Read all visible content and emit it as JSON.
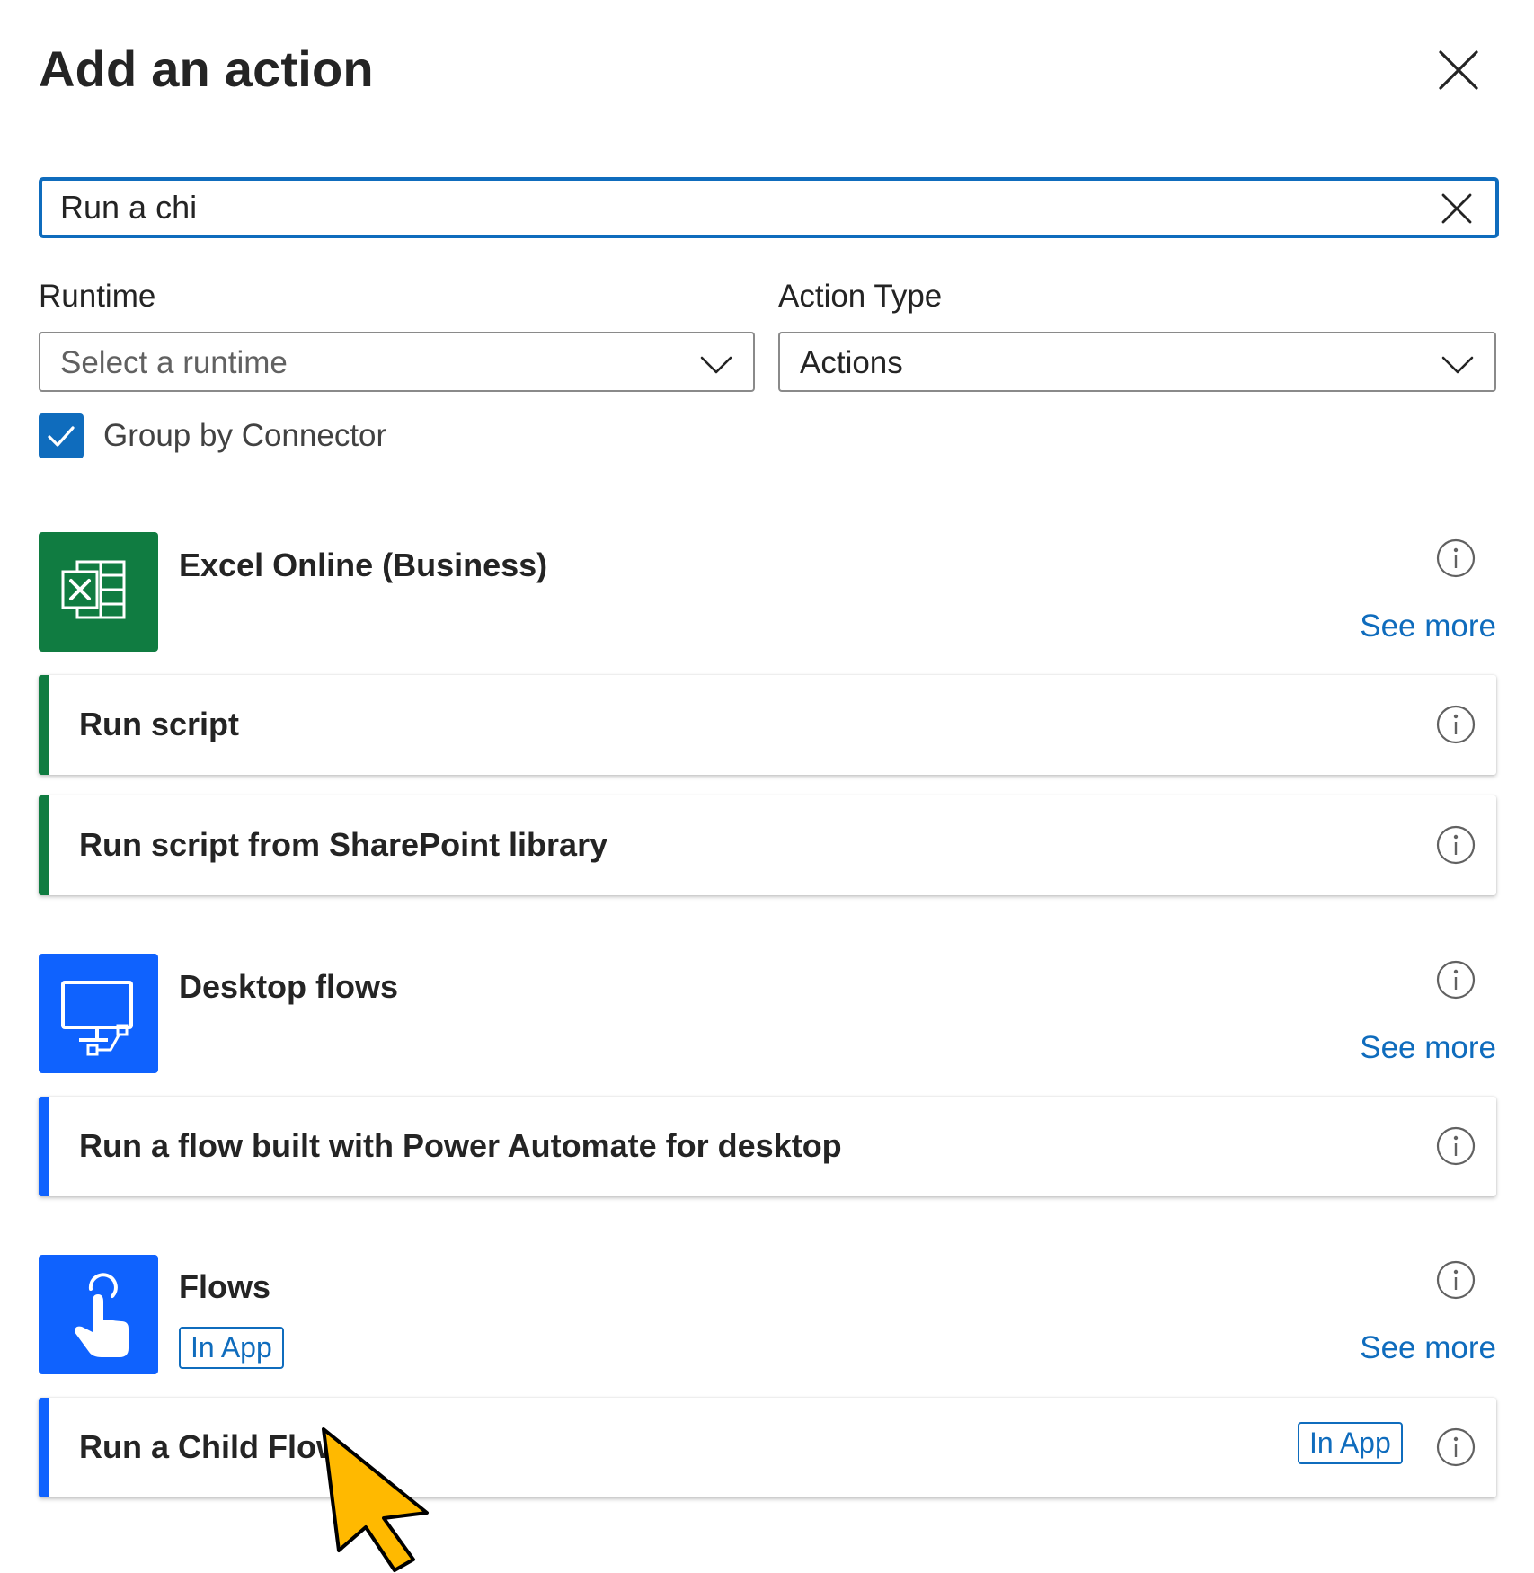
{
  "panel": {
    "title": "Add an action"
  },
  "search": {
    "value": "Run a chi",
    "placeholder": ""
  },
  "filters": {
    "runtime_label": "Runtime",
    "runtime_value": "Select a runtime",
    "action_type_label": "Action Type",
    "action_type_value": "Actions"
  },
  "group_by": {
    "label": "Group by Connector",
    "checked": true
  },
  "connectors": [
    {
      "name": "Excel Online (Business)",
      "icon": "excel-icon",
      "color": "#107c41",
      "see_more": "See more",
      "actions": [
        {
          "label": "Run script"
        },
        {
          "label": "Run script from SharePoint library"
        }
      ]
    },
    {
      "name": "Desktop flows",
      "icon": "desktop-flow-icon",
      "color": "#0f62fe",
      "see_more": "See more",
      "actions": [
        {
          "label": "Run a flow built with Power Automate for desktop"
        }
      ]
    },
    {
      "name": "Flows",
      "icon": "touch-hand-icon",
      "color": "#0f62fe",
      "badge": "In App",
      "see_more": "See more",
      "actions": [
        {
          "label": "Run a Child Flow",
          "badge": "In App"
        }
      ]
    }
  ],
  "colors": {
    "accent": "#0f6cbd",
    "cursor": "#ffb900"
  }
}
